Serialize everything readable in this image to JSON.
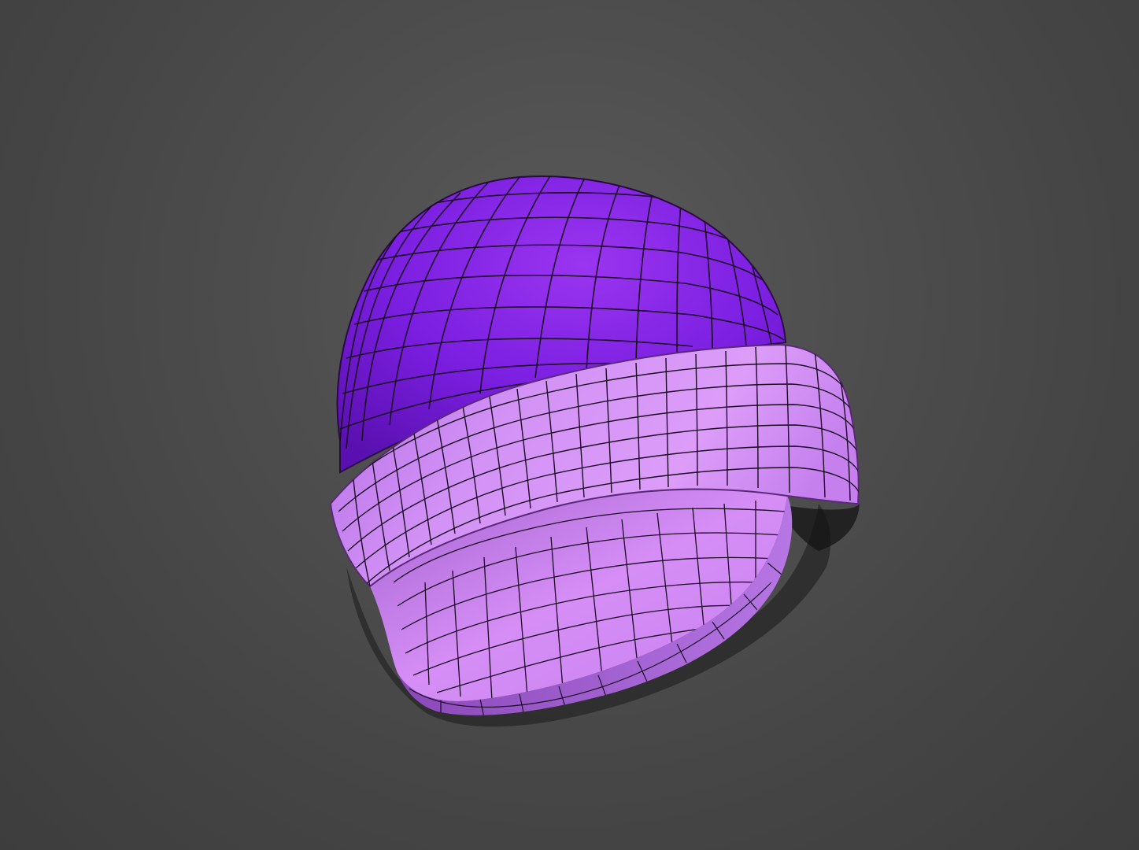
{
  "scene": {
    "object": "beanie-hat-wireframe-render",
    "colors": {
      "background_center": "#5a5a5a",
      "background_edge": "#3d3d3d",
      "crown_light": "#9a35f0",
      "crown_mid": "#7a1ee0",
      "crown_dark": "#5a10b0",
      "cuff_light": "#dc9cf8",
      "cuff_mid": "#c57bf0",
      "cuff_dark": "#9c55c8",
      "inner_light": "#d68ef6",
      "inner_dark": "#a463d0",
      "wire": "#1a0a22",
      "shadow": "#000000"
    }
  }
}
